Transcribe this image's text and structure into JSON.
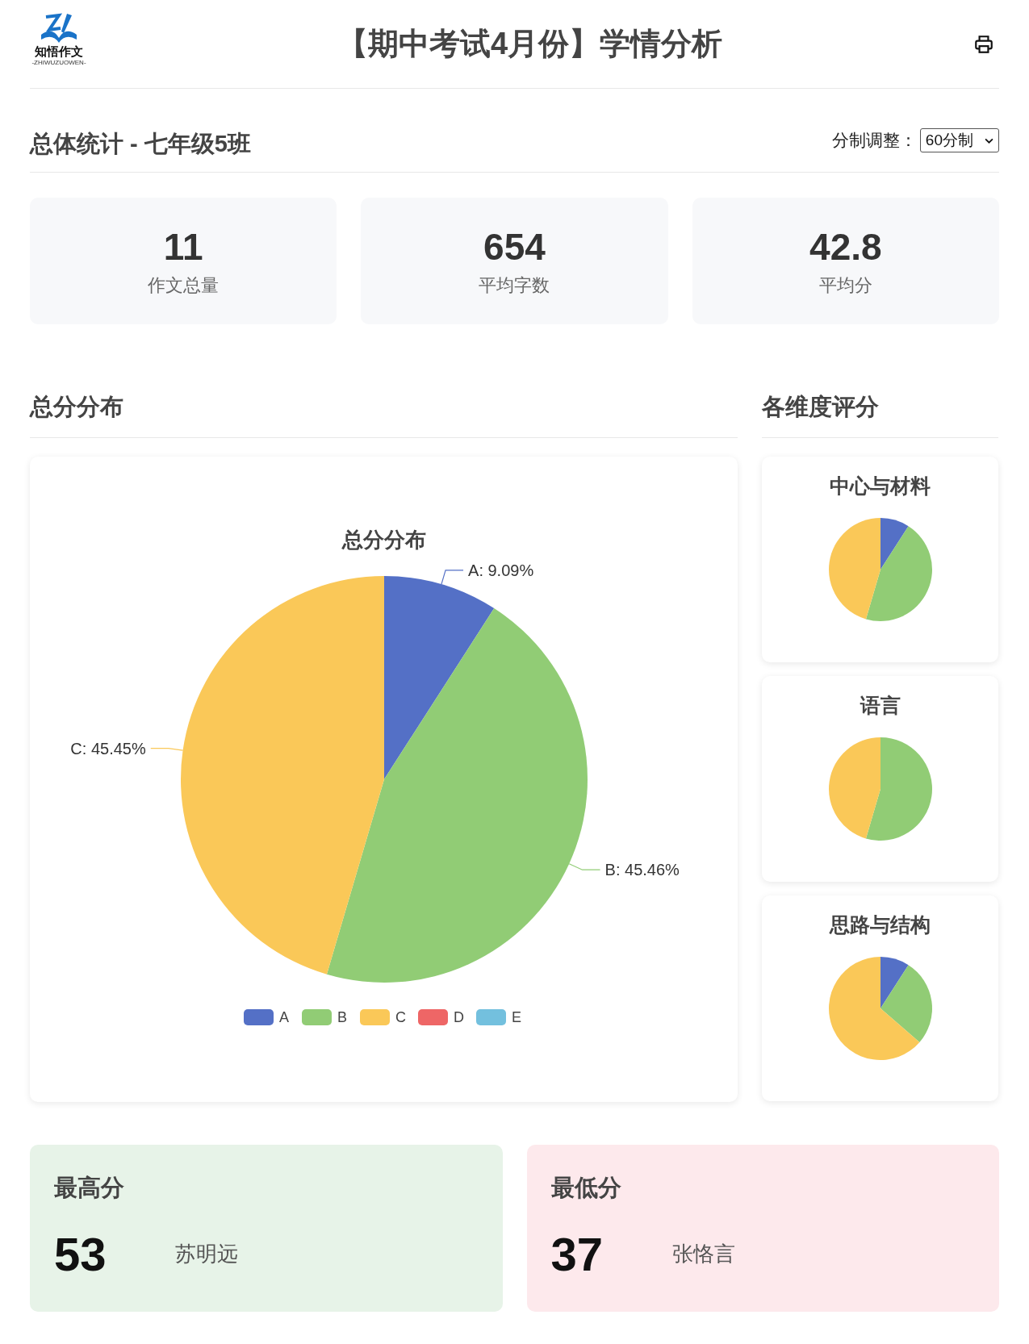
{
  "header": {
    "logo": {
      "name": "知悟作文",
      "subtitle": "-ZHIWUZUOWEN-"
    },
    "title": "【期中考试4月份】学情分析"
  },
  "overview": {
    "title": "总体统计 - 七年级5班",
    "scale_label": "分制调整：",
    "scale_value": "60分制",
    "stats": [
      {
        "value": "11",
        "label": "作文总量"
      },
      {
        "value": "654",
        "label": "平均字数"
      },
      {
        "value": "42.8",
        "label": "平均分"
      }
    ]
  },
  "distribution": {
    "heading": "总分分布",
    "chart_data": {
      "type": "pie",
      "title": "总分分布",
      "categories": [
        "A",
        "B",
        "C",
        "D",
        "E"
      ],
      "values": [
        9.09,
        45.46,
        45.45,
        0,
        0
      ],
      "value_labels": [
        "A: 9.09%",
        "B: 45.46%",
        "C: 45.45%",
        null,
        null
      ],
      "legend": true
    },
    "colors": [
      {
        "color": "#5470c6"
      },
      {
        "color": "#91cc75"
      },
      {
        "color": "#fac858"
      },
      {
        "color": "#ee6666"
      },
      {
        "color": "#73c0de"
      }
    ]
  },
  "dimensions": {
    "heading": "各维度评分",
    "charts": [
      {
        "chart_data": {
          "type": "pie",
          "title": "中心与材料",
          "values": [
            9.09,
            45.45,
            45.45,
            0,
            0
          ]
        }
      },
      {
        "chart_data": {
          "type": "pie",
          "title": "语言",
          "values": [
            0,
            54.55,
            45.45,
            0,
            0
          ]
        }
      },
      {
        "chart_data": {
          "type": "pie",
          "title": "思路与结构",
          "values": [
            9.09,
            27.27,
            63.64,
            0,
            0
          ]
        }
      }
    ]
  },
  "extremes": [
    {
      "kind": "highest",
      "title": "最高分",
      "score": "53",
      "name": "苏明远"
    },
    {
      "kind": "lowest",
      "title": "最低分",
      "score": "37",
      "name": "张恪言"
    }
  ]
}
